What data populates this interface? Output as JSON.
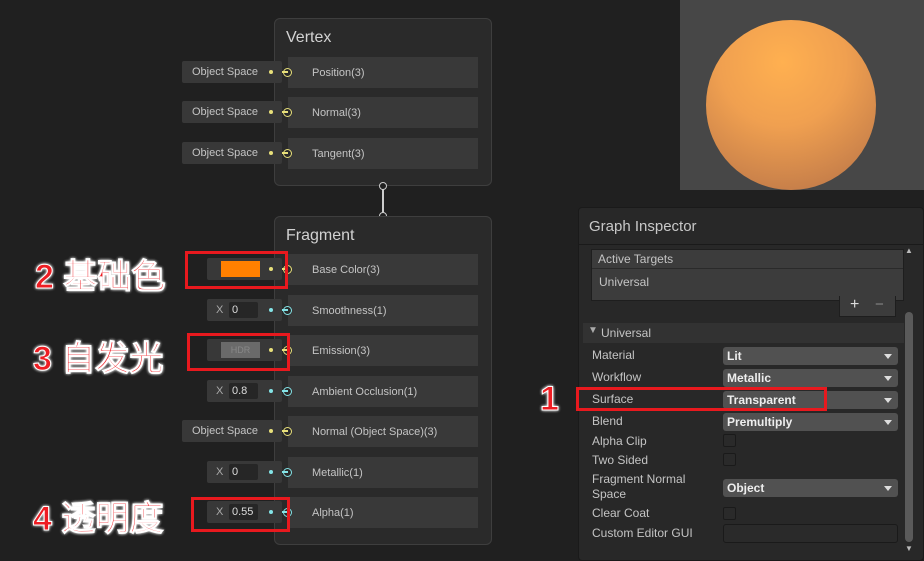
{
  "vertex": {
    "title": "Vertex",
    "ports": [
      {
        "label": "Position(3)",
        "input": "Object Space"
      },
      {
        "label": "Normal(3)",
        "input": "Object Space"
      },
      {
        "label": "Tangent(3)",
        "input": "Object Space"
      }
    ]
  },
  "fragment": {
    "title": "Fragment",
    "ports": [
      {
        "label": "Base Color(3)",
        "input_type": "color",
        "color": "#ff8000"
      },
      {
        "label": "Smoothness(1)",
        "input_axis": "X",
        "input": "0"
      },
      {
        "label": "Emission(3)",
        "input_type": "hdr-color",
        "input": "HDR",
        "color": "#6a6a6a"
      },
      {
        "label": "Ambient Occlusion(1)",
        "input_axis": "X",
        "input": "0.8"
      },
      {
        "label": "Normal (Object Space)(3)",
        "input": "Object Space"
      },
      {
        "label": "Metallic(1)",
        "input_axis": "X",
        "input": "0"
      },
      {
        "label": "Alpha(1)",
        "input_axis": "X",
        "input": "0.55"
      }
    ]
  },
  "inspector": {
    "title": "Graph Inspector",
    "active_targets_header": "Active Targets",
    "active_target": "Universal",
    "add": "+",
    "remove": "−",
    "section": "Universal",
    "material": {
      "label": "Material",
      "value": "Lit"
    },
    "workflow": {
      "label": "Workflow",
      "value": "Metallic"
    },
    "surface": {
      "label": "Surface",
      "value": "Transparent"
    },
    "blend": {
      "label": "Blend",
      "value": "Premultiply"
    },
    "alpha_clip": {
      "label": "Alpha Clip",
      "checked": false
    },
    "two_sided": {
      "label": "Two Sided",
      "checked": false
    },
    "fragment_normal_space": {
      "label1": "Fragment Normal",
      "label2": "Space",
      "value": "Object"
    },
    "clear_coat": {
      "label": "Clear Coat",
      "checked": false
    },
    "custom_editor_gui": {
      "label": "Custom Editor GUI",
      "value": ""
    }
  },
  "annotations": {
    "a1": "1",
    "a2": "2 基础色",
    "a3": "3 自发光",
    "a4": "4 透明度"
  },
  "colors": {
    "annotation": "#e8191e",
    "vector3_port": "#e8e07a",
    "float_port": "#84e4e7"
  }
}
